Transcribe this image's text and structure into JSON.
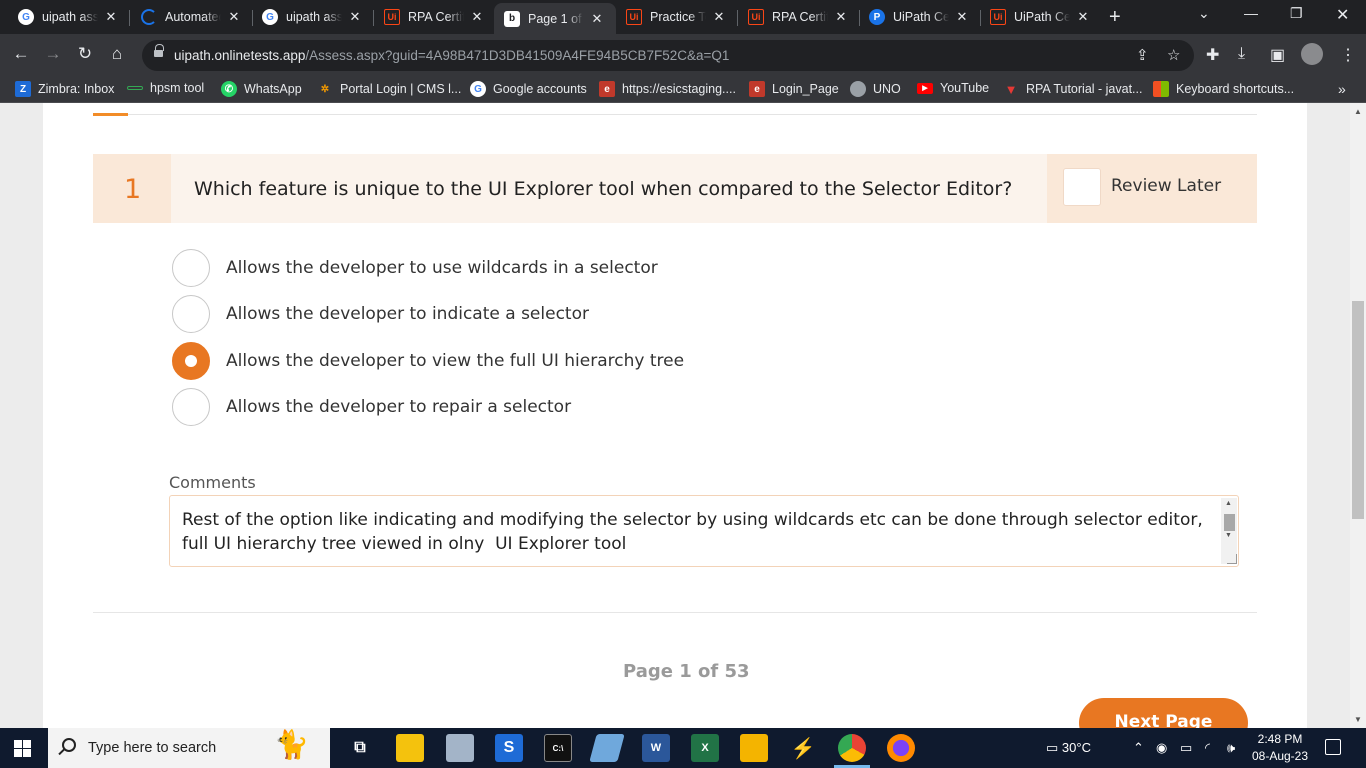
{
  "browser": {
    "tabs": [
      {
        "title": "uipath asso",
        "icon": "google-icon",
        "active": false
      },
      {
        "title": "Automated",
        "icon": "loading-icon",
        "active": false
      },
      {
        "title": "uipath asso",
        "icon": "google-icon",
        "active": false
      },
      {
        "title": "RPA Certific",
        "icon": "uipath-icon",
        "active": false
      },
      {
        "title": "Page 1 of 5",
        "icon": "b-icon",
        "active": true
      },
      {
        "title": "Practice Te",
        "icon": "uipath-icon",
        "active": false
      },
      {
        "title": "RPA Certific",
        "icon": "uipath-icon",
        "active": false
      },
      {
        "title": "UiPath Cer",
        "icon": "p-icon",
        "active": false
      },
      {
        "title": "UiPath Cer",
        "icon": "uipath-icon",
        "active": false
      }
    ],
    "address": {
      "host": "uipath.onlinetests.app",
      "path": "/Assess.aspx?guid=4A98B471D3DB41509A4FE94B5CB7F52C&a=Q1"
    },
    "bookmarks": [
      {
        "label": "Zimbra: Inbox",
        "icon": "zimbra-icon"
      },
      {
        "label": "hpsm tool",
        "icon": "link-icon"
      },
      {
        "label": "WhatsApp",
        "icon": "whatsapp-icon"
      },
      {
        "label": "Portal Login | CMS l...",
        "icon": "portal-icon"
      },
      {
        "label": "Google accounts",
        "icon": "google-icon"
      },
      {
        "label": "https://esicstaging....",
        "icon": "esic-icon"
      },
      {
        "label": "Login_Page",
        "icon": "esic-icon"
      },
      {
        "label": "UNO",
        "icon": "globe-icon"
      },
      {
        "label": "YouTube",
        "icon": "youtube-icon"
      },
      {
        "label": "RPA Tutorial - javat...",
        "icon": "javatpoint-icon"
      },
      {
        "label": "Keyboard shortcuts...",
        "icon": "microsoft-icon"
      }
    ],
    "bookmarks_overflow": "»"
  },
  "quiz": {
    "question_number": "1",
    "question_text": "Which feature is unique to the UI Explorer tool when compared to the Selector Editor?",
    "review_later_label": "Review Later",
    "review_later_checked": false,
    "options": [
      {
        "label": "Allows the developer to use wildcards in a selector",
        "selected": false
      },
      {
        "label": "Allows the developer to indicate a selector",
        "selected": false
      },
      {
        "label": "Allows the developer to view the full UI hierarchy tree",
        "selected": true
      },
      {
        "label": "Allows the developer to repair a selector",
        "selected": false
      }
    ],
    "comments_label": "Comments",
    "comments_value": "Rest of the option like indicating and modifying the selector by using wildcards etc can be done through selector editor,\nfull UI hierarchy tree viewed in olny  UI Explorer tool",
    "pager_text": "Page 1 of 53",
    "next_button_label": "Next Page"
  },
  "taskbar": {
    "search_placeholder": "Type here to search",
    "weather": "30°C",
    "time": "2:48 PM",
    "date": "08-Aug-23"
  },
  "colors": {
    "accent": "#e87722",
    "question_bg": "#fbf3ec",
    "question_num_bg": "#fae8d8"
  }
}
